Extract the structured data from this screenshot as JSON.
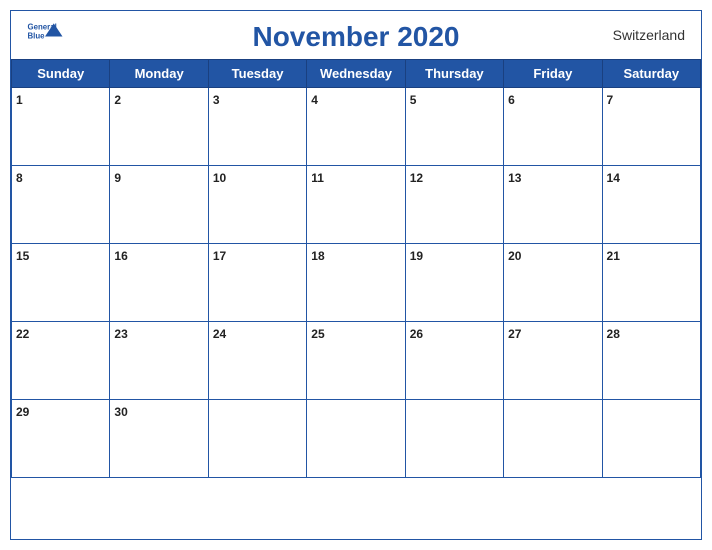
{
  "calendar": {
    "title": "November 2020",
    "country": "Switzerland",
    "logo": {
      "line1": "General",
      "line2": "Blue"
    },
    "days_of_week": [
      "Sunday",
      "Monday",
      "Tuesday",
      "Wednesday",
      "Thursday",
      "Friday",
      "Saturday"
    ],
    "weeks": [
      [
        {
          "day": 1,
          "empty": false
        },
        {
          "day": 2,
          "empty": false
        },
        {
          "day": 3,
          "empty": false
        },
        {
          "day": 4,
          "empty": false
        },
        {
          "day": 5,
          "empty": false
        },
        {
          "day": 6,
          "empty": false
        },
        {
          "day": 7,
          "empty": false
        }
      ],
      [
        {
          "day": 8,
          "empty": false
        },
        {
          "day": 9,
          "empty": false
        },
        {
          "day": 10,
          "empty": false
        },
        {
          "day": 11,
          "empty": false
        },
        {
          "day": 12,
          "empty": false
        },
        {
          "day": 13,
          "empty": false
        },
        {
          "day": 14,
          "empty": false
        }
      ],
      [
        {
          "day": 15,
          "empty": false
        },
        {
          "day": 16,
          "empty": false
        },
        {
          "day": 17,
          "empty": false
        },
        {
          "day": 18,
          "empty": false
        },
        {
          "day": 19,
          "empty": false
        },
        {
          "day": 20,
          "empty": false
        },
        {
          "day": 21,
          "empty": false
        }
      ],
      [
        {
          "day": 22,
          "empty": false
        },
        {
          "day": 23,
          "empty": false
        },
        {
          "day": 24,
          "empty": false
        },
        {
          "day": 25,
          "empty": false
        },
        {
          "day": 26,
          "empty": false
        },
        {
          "day": 27,
          "empty": false
        },
        {
          "day": 28,
          "empty": false
        }
      ],
      [
        {
          "day": 29,
          "empty": false
        },
        {
          "day": 30,
          "empty": false
        },
        {
          "day": null,
          "empty": true
        },
        {
          "day": null,
          "empty": true
        },
        {
          "day": null,
          "empty": true
        },
        {
          "day": null,
          "empty": true
        },
        {
          "day": null,
          "empty": true
        }
      ]
    ]
  }
}
